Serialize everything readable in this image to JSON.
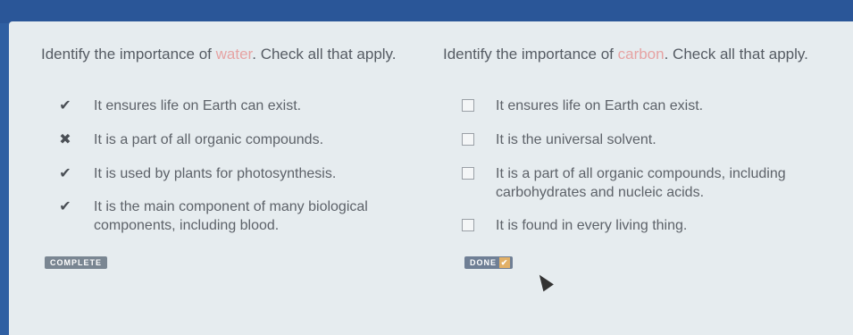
{
  "left": {
    "prompt_start": "Identify the importance of ",
    "prompt_keyword": "water",
    "prompt_end": ". Check all that apply.",
    "options": [
      {
        "mark": "check",
        "text": "It ensures life on Earth can exist."
      },
      {
        "mark": "x",
        "text": "It is a part of all organic compounds."
      },
      {
        "mark": "check",
        "text": "It is used by plants for photosynthesis."
      },
      {
        "mark": "check",
        "text": "It is the main component of many biological components, including blood."
      }
    ],
    "button_label": "COMPLETE"
  },
  "right": {
    "prompt_start": "Identify the importance of ",
    "prompt_keyword": "carbon",
    "prompt_end": ". Check all that apply.",
    "options": [
      {
        "text": "It ensures life on Earth can exist."
      },
      {
        "text": "It is the universal solvent."
      },
      {
        "text": "It is a part of all organic compounds, including carbohydrates and nucleic acids."
      },
      {
        "text": "It is found in every living thing."
      }
    ],
    "button_label": "DONE"
  },
  "icons": {
    "check": "✔",
    "x": "✖",
    "done_check": "✔"
  }
}
